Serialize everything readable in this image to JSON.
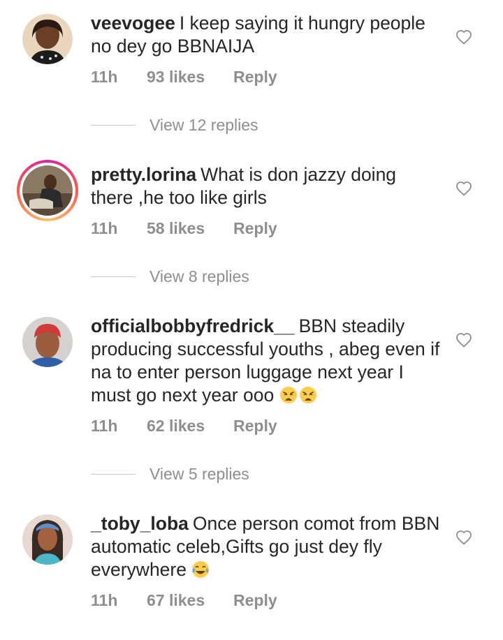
{
  "comments": [
    {
      "username": "veevogee",
      "text": "I keep saying it hungry people no dey go BBNAIJA",
      "time": "11h",
      "likes": "93 likes",
      "reply": "Reply",
      "view_replies": "View 12 replies",
      "avatar_ring": false
    },
    {
      "username": "pretty.lorina",
      "text": "What is don jazzy doing there ,he too like girls",
      "time": "11h",
      "likes": "58 likes",
      "reply": "Reply",
      "view_replies": "View 8 replies",
      "avatar_ring": true
    },
    {
      "username": "officialbobbyfredrick__",
      "text": "BBN steadily producing successful youths , abeg even if na to enter person luggage next year I must go next year ooo",
      "emoji": [
        "weary-face",
        "weary-face"
      ],
      "time": "11h",
      "likes": "62 likes",
      "reply": "Reply",
      "view_replies": "View 5 replies",
      "avatar_ring": false
    },
    {
      "username": "_toby_loba",
      "text": "Once person comot from BBN automatic celeb,Gifts go just dey fly everywhere",
      "emoji": [
        "tears-of-joy-face"
      ],
      "time": "11h",
      "likes": "67 likes",
      "reply": "Reply",
      "avatar_ring": false
    }
  ],
  "colors": {
    "text": "#262626",
    "meta": "#8e8e8e",
    "divider": "#c7c7c7"
  }
}
